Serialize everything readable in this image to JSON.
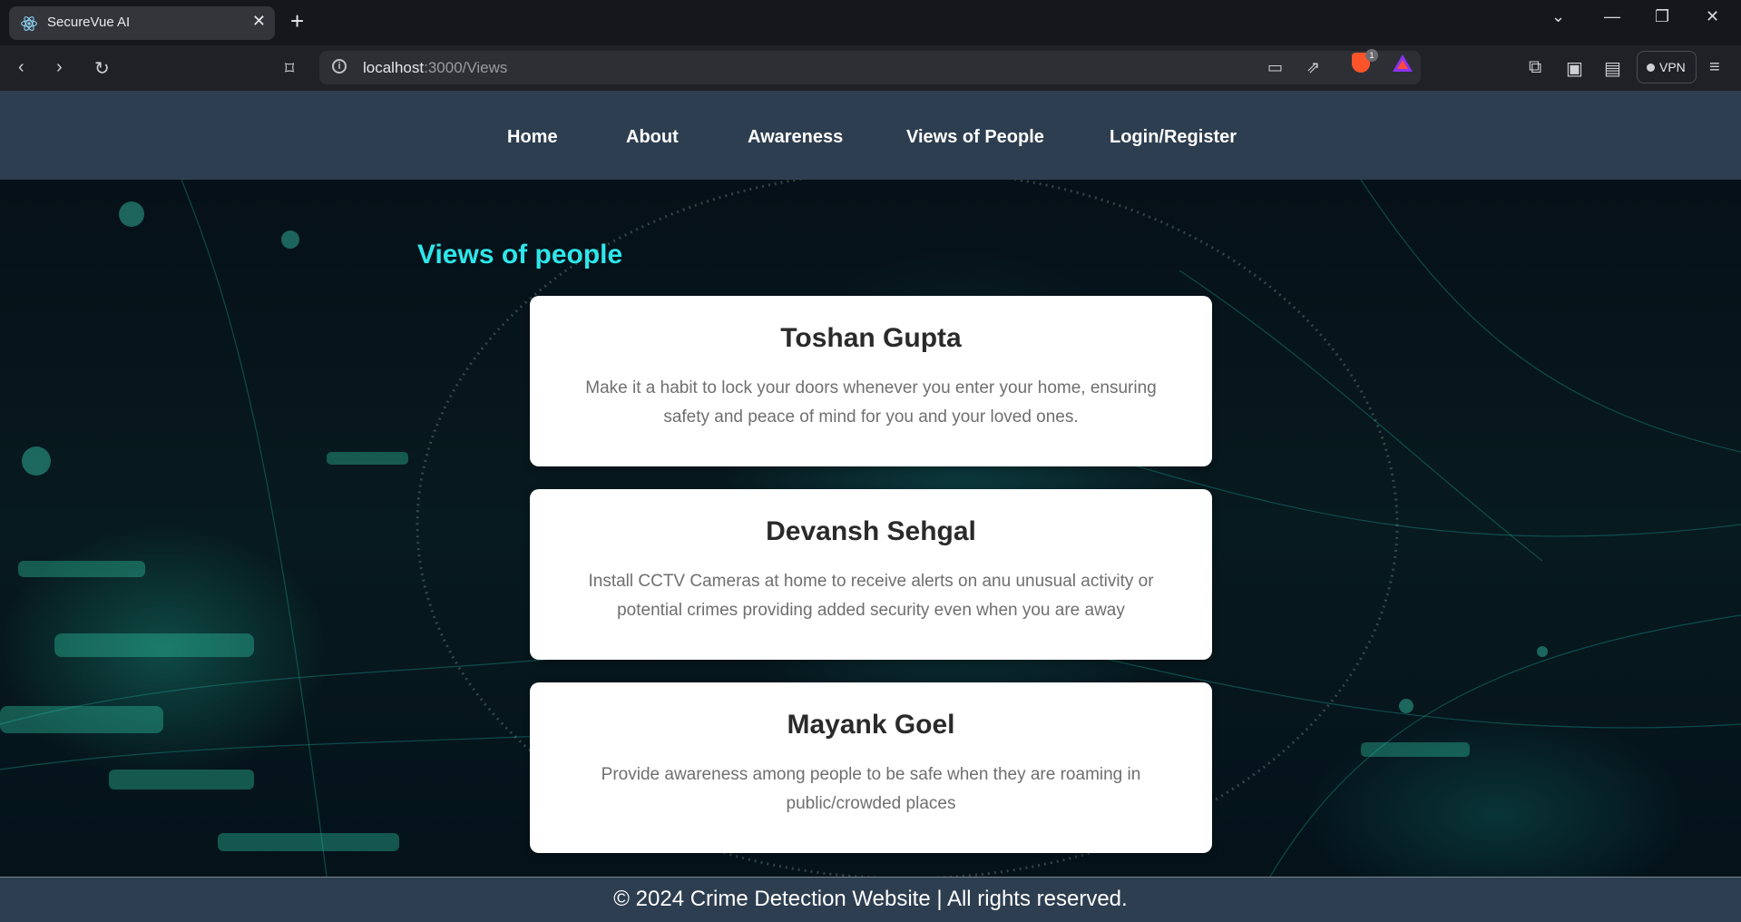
{
  "browser": {
    "tab_title": "SecureVue AI",
    "url_host": "localhost",
    "url_path": ":3000/Views",
    "vpn_label": "VPN",
    "shields_badge": "1",
    "icons": {
      "favicon": "react-logo-icon",
      "back": "back-arrow-icon",
      "forward": "forward-arrow-icon",
      "reload": "reload-icon",
      "bookmark": "bookmark-icon",
      "site_info": "info-icon",
      "install": "install-app-icon",
      "share": "share-icon",
      "shields": "brave-shields-icon",
      "rewards": "brave-rewards-icon",
      "extensions": "puzzle-icon",
      "sidebar": "sidebar-icon",
      "wallet": "wallet-icon",
      "menu": "hamburger-menu-icon"
    }
  },
  "nav": {
    "items": [
      {
        "label": "Home"
      },
      {
        "label": "About"
      },
      {
        "label": "Awareness"
      },
      {
        "label": "Views of People"
      },
      {
        "label": "Login/Register"
      }
    ]
  },
  "section": {
    "title": "Views of people"
  },
  "views": [
    {
      "name": "Toshan Gupta",
      "text": "Make it a habit to lock your doors whenever you enter your home, ensuring safety and peace of mind for you and your loved ones."
    },
    {
      "name": "Devansh Sehgal",
      "text": "Install CCTV Cameras at home to receive alerts on anu unusual activity or potential crimes providing added security even when you are away"
    },
    {
      "name": "Mayank Goel",
      "text": "Provide awareness among people to be safe when they are roaming in public/crowded places"
    }
  ],
  "footer": {
    "text": "© 2024 Crime Detection Website | All rights reserved."
  },
  "colors": {
    "navbar": "#2d3e50",
    "accent_title": "#2ee6ea",
    "card_bg": "#ffffff",
    "card_name": "#2a2a2a",
    "card_text": "#6f6f6f"
  }
}
